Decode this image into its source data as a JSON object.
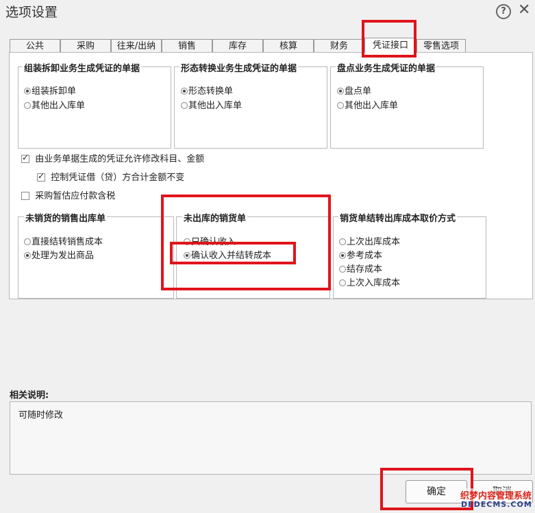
{
  "window": {
    "title": "选项设置",
    "help_glyph": "?",
    "close_glyph": "✕"
  },
  "tabs": [
    {
      "label": "公共"
    },
    {
      "label": "采购"
    },
    {
      "label": "往来/出纳"
    },
    {
      "label": "销售"
    },
    {
      "label": "库存"
    },
    {
      "label": "核算"
    },
    {
      "label": "财务"
    },
    {
      "label": "凭证接口",
      "active": true
    },
    {
      "label": "零售选项"
    }
  ],
  "groups": {
    "assembly": {
      "title": "组装拆卸业务生成凭证的单据",
      "options": [
        {
          "label": "组装拆卸单",
          "checked": true
        },
        {
          "label": "其他出入库单",
          "checked": false
        }
      ]
    },
    "transform": {
      "title": "形态转换业务生成凭证的单据",
      "options": [
        {
          "label": "形态转换单",
          "checked": true
        },
        {
          "label": "其他出入库单",
          "checked": false
        }
      ]
    },
    "stocktake": {
      "title": "盘点业务生成凭证的单据",
      "options": [
        {
          "label": "盘点单",
          "checked": true
        },
        {
          "label": "其他出入库单",
          "checked": false
        }
      ]
    },
    "unsold_out": {
      "title": "未销货的销售出库单",
      "options": [
        {
          "label": "直接结转销售成本",
          "checked": false
        },
        {
          "label": "处理为发出商品",
          "checked": true
        }
      ]
    },
    "unshipped_sale": {
      "title": "未出库的销货单",
      "options": [
        {
          "label": "只确认收入",
          "checked": false
        },
        {
          "label": "确认收入并结转成本",
          "checked": true
        }
      ]
    },
    "cost_method": {
      "title": "销货单结转出库成本取价方式",
      "options": [
        {
          "label": "上次出库成本",
          "checked": false
        },
        {
          "label": "参考成本",
          "checked": true
        },
        {
          "label": "结存成本",
          "checked": false
        },
        {
          "label": "上次入库成本",
          "checked": false
        }
      ]
    }
  },
  "checkboxes": {
    "allow_modify": {
      "label": "由业务单据生成的凭证允许修改科目、金额",
      "checked": true
    },
    "keep_total": {
      "label": "控制凭证借（贷）方合计金额不变",
      "checked": true
    },
    "estimate_tax": {
      "label": "采购暂估应付款含税",
      "checked": false
    }
  },
  "description": {
    "label": "相关说明:",
    "text": "可随时修改"
  },
  "buttons": {
    "ok": "确定",
    "cancel": "取消"
  },
  "watermark": {
    "line1": "织梦内容管理系统",
    "line2": "DEDECMS.COM"
  },
  "colors": {
    "highlight": "#e0141c",
    "background": "#f0f0f0",
    "panel": "#ffffff"
  }
}
